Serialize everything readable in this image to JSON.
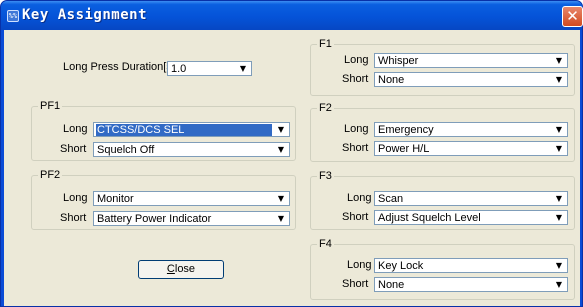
{
  "window": {
    "title": "Key Assignment",
    "icon_text": "%%",
    "close_glyph": "✕"
  },
  "long_press": {
    "label": "Long Press Duration[s]",
    "value": "1.0"
  },
  "groups": {
    "pf1": {
      "title": "PF1",
      "long_label": "Long",
      "long_value": "CTCSS/DCS SEL",
      "short_label": "Short",
      "short_value": "Squelch Off"
    },
    "pf2": {
      "title": "PF2",
      "long_label": "Long",
      "long_value": "Monitor",
      "short_label": "Short",
      "short_value": "Battery Power Indicator"
    },
    "f1": {
      "title": "F1",
      "long_label": "Long",
      "long_value": "Whisper",
      "short_label": "Short",
      "short_value": "None"
    },
    "f2": {
      "title": "F2",
      "long_label": "Long",
      "long_value": "Emergency",
      "short_label": "Short",
      "short_value": "Power H/L"
    },
    "f3": {
      "title": "F3",
      "long_label": "Long",
      "long_value": "Scan",
      "short_label": "Short",
      "short_value": "Adjust Squelch Level"
    },
    "f4": {
      "title": "F4",
      "long_label": "Long",
      "long_value": "Key Lock",
      "short_label": "Short",
      "short_value": "None"
    }
  },
  "buttons": {
    "close_mnemonic": "C",
    "close_rest": "lose"
  },
  "icons": {
    "dropdown_arrow": "▼"
  },
  "colors": {
    "titlebar": "#0553d8",
    "dialog_bg": "#ece9d8",
    "selection": "#316ac5"
  }
}
